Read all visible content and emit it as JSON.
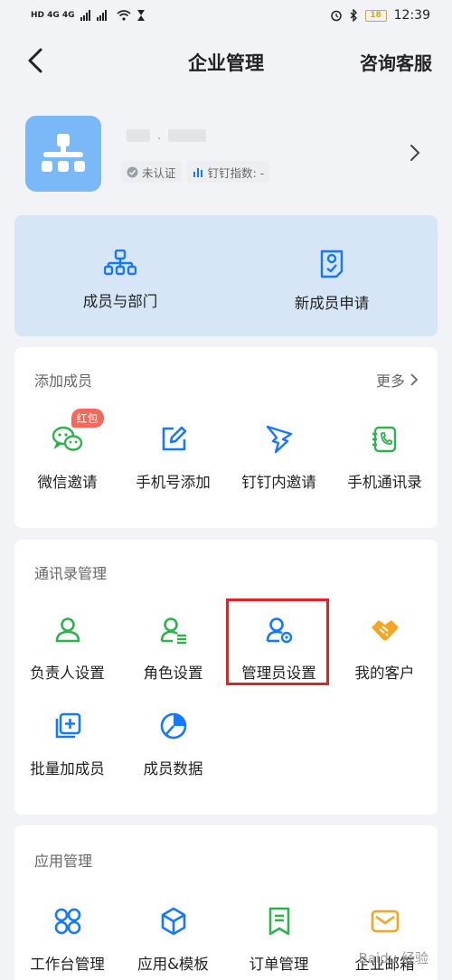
{
  "status": {
    "left": "HD 4G 4G",
    "time": "12:39",
    "battery": "18"
  },
  "nav": {
    "title": "企业管理",
    "right": "咨询客服"
  },
  "org": {
    "name_masked": ".",
    "verify": "未认证",
    "index": "钉钉指数: -"
  },
  "quick": [
    {
      "label": "成员与部门",
      "icon": "org-tree-icon"
    },
    {
      "label": "新成员申请",
      "icon": "member-apply-icon"
    }
  ],
  "add_members": {
    "title": "添加成员",
    "more": "更多",
    "badge": "红包",
    "items": [
      {
        "label": "微信邀请",
        "icon": "wechat-icon"
      },
      {
        "label": "手机号添加",
        "icon": "edit-icon"
      },
      {
        "label": "钉钉内邀请",
        "icon": "dingtalk-icon"
      },
      {
        "label": "手机通讯录",
        "icon": "phone-book-icon"
      }
    ]
  },
  "contacts": {
    "title": "通讯录管理",
    "items": [
      {
        "label": "负责人设置",
        "icon": "manager-icon"
      },
      {
        "label": "角色设置",
        "icon": "role-icon"
      },
      {
        "label": "管理员设置",
        "icon": "admin-icon"
      },
      {
        "label": "我的客户",
        "icon": "handshake-icon"
      },
      {
        "label": "批量加成员",
        "icon": "batch-add-icon"
      },
      {
        "label": "成员数据",
        "icon": "pie-chart-icon"
      }
    ]
  },
  "apps": {
    "title": "应用管理",
    "items": [
      {
        "label": "工作台管理",
        "icon": "workbench-icon"
      },
      {
        "label": "应用&模板",
        "icon": "cube-icon"
      },
      {
        "label": "订单管理",
        "icon": "bookmark-icon"
      },
      {
        "label": "企业邮箱",
        "icon": "mail-icon"
      }
    ]
  },
  "watermark": "Baidu 经验",
  "colors": {
    "blue": "#1677ff",
    "green": "#2fb14e",
    "orange": "#f5a623",
    "highlight": "#e02424"
  }
}
